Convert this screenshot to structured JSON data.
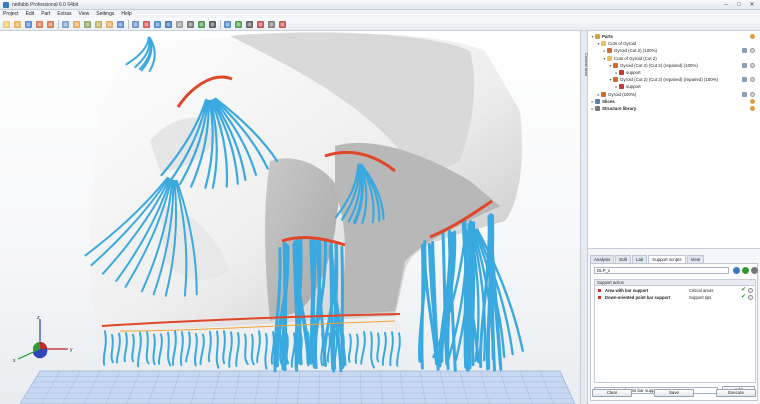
{
  "window": {
    "title": "netfabb Professional 6.0 64bit",
    "minimize": "–",
    "maximize": "□",
    "close": "✕"
  },
  "menu": [
    "Project",
    "Edit",
    "Part",
    "Extras",
    "View",
    "Settings",
    "Help"
  ],
  "toolbar": {
    "icons": [
      "new-icon",
      "open-icon",
      "save-icon",
      "undo-icon",
      "redo-icon",
      "select-icon",
      "transform-icon",
      "rotate-icon",
      "lasso-icon",
      "zoom-icon",
      "search-icon",
      "view-icon",
      "support-icon",
      "slice-icon",
      "cut-icon",
      "measure-icon",
      "align-icon",
      "repair-icon",
      "scale-icon",
      "grid-icon",
      "check-icon",
      "pen-icon",
      "brush-icon",
      "text-icon",
      "wand-icon"
    ]
  },
  "side_tab": {
    "label": "Context area"
  },
  "tree": [
    {
      "label": "Parts",
      "depth": 0,
      "bold": true,
      "expanded": true,
      "icon": "parts-icon"
    },
    {
      "label": "Cuts of Gyroid",
      "depth": 1,
      "bold": false,
      "expanded": true,
      "icon": "folder-icon"
    },
    {
      "label": "Gyroid (Cut 2) (100%)",
      "depth": 2,
      "bold": false,
      "expanded": false,
      "icon": "part-icon"
    },
    {
      "label": "Cuts of Gyroid (Cut 2)",
      "depth": 2,
      "bold": false,
      "expanded": true,
      "icon": "folder-icon"
    },
    {
      "label": "Gyroid (Cut 2) (Cut 2) (repaired) (100%)",
      "depth": 3,
      "bold": false,
      "expanded": true,
      "icon": "part-icon"
    },
    {
      "label": "support",
      "depth": 4,
      "bold": false,
      "expanded": false,
      "icon": "support-icon"
    },
    {
      "label": "Gyroid (Cut 2) (Cut 2) (repaired) (repaired) (100%)",
      "depth": 3,
      "bold": false,
      "expanded": true,
      "icon": "part-icon"
    },
    {
      "label": "support",
      "depth": 4,
      "bold": false,
      "expanded": false,
      "icon": "support-icon"
    },
    {
      "label": "Gyroid (100%)",
      "depth": 1,
      "bold": false,
      "expanded": false,
      "icon": "part-icon"
    },
    {
      "label": "Slices",
      "depth": 0,
      "bold": true,
      "expanded": false,
      "icon": "slices-icon"
    },
    {
      "label": "Structure library",
      "depth": 0,
      "bold": true,
      "expanded": false,
      "icon": "library-icon"
    }
  ],
  "tabs": [
    "Analysis",
    "Edit",
    "Lab",
    "Support scripts",
    "View"
  ],
  "active_tab": "Support scripts",
  "script": {
    "selected": "DLP_x",
    "column_header": "Support action",
    "rows": [
      {
        "action": "Area with bar support",
        "target": "Critical areas"
      },
      {
        "action": "Down-oriented point bar support",
        "target": "Support tips"
      }
    ],
    "add_select": "Down-oriented point bar support",
    "add_label": "Add",
    "clear_label": "Clear",
    "save_label": "Save",
    "execute_label": "Execute"
  },
  "axis": {
    "x": "x",
    "y": "y",
    "z": "z"
  },
  "colors": {
    "support": "#3aa9e0",
    "critical": "#e0462a",
    "platform": "#b9cbe8",
    "model": "#f4f4f4"
  }
}
